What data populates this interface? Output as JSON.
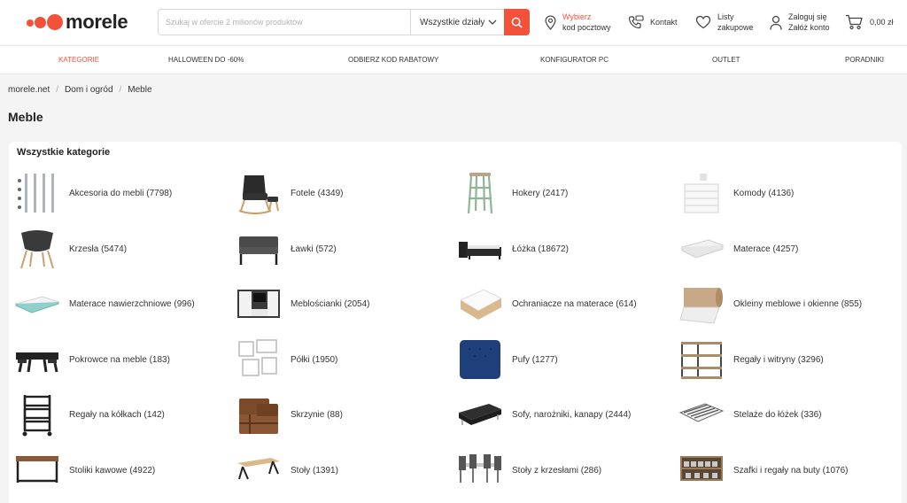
{
  "brand": {
    "name": "morele",
    "color": "#f4513a"
  },
  "search": {
    "placeholder": "Szukaj w ofercie 2 milionów produktów",
    "category": "Wszystkie działy"
  },
  "header": {
    "postcode_title": "Wybierz",
    "postcode_sub": "kod pocztowy",
    "contact": "Kontakt",
    "lists_line1": "Listy",
    "lists_line2": "zakupowe",
    "login_line1": "Zaloguj się",
    "login_line2": "Załóż konto",
    "cart_total": "0,00 zł"
  },
  "nav": [
    "KATEGORIE",
    "HALLOWEEN DO -60%",
    "ODBIERZ KOD RABATOWY",
    "KONFIGURATOR PC",
    "OUTLET",
    "PORADNIKI"
  ],
  "breadcrumb": [
    "morele.net",
    "Dom i ogród",
    "Meble"
  ],
  "page_title": "Meble",
  "section_title": "Wszystkie kategorie",
  "categories": [
    {
      "label": "Akcesoria do mebli (7798)",
      "icon": "furniture-legs-icon"
    },
    {
      "label": "Fotele (4349)",
      "icon": "armchair-icon"
    },
    {
      "label": "Hokery (2417)",
      "icon": "bar-stool-icon"
    },
    {
      "label": "Komody (4136)",
      "icon": "dresser-icon"
    },
    {
      "label": "Krzesła (5474)",
      "icon": "chair-icon"
    },
    {
      "label": "Ławki (572)",
      "icon": "bench-icon"
    },
    {
      "label": "Łóżka (18672)",
      "icon": "bed-icon"
    },
    {
      "label": "Materace (4257)",
      "icon": "mattress-icon"
    },
    {
      "label": "Materace nawierzchniowe (996)",
      "icon": "mattress-topper-icon"
    },
    {
      "label": "Meblościanki (2054)",
      "icon": "wall-unit-icon"
    },
    {
      "label": "Ochraniacze na materace (614)",
      "icon": "mattress-protector-icon"
    },
    {
      "label": "Okleiny meblowe i okienne (855)",
      "icon": "veneer-roll-icon"
    },
    {
      "label": "Pokrowce na meble (183)",
      "icon": "furniture-cover-icon"
    },
    {
      "label": "Półki (1950)",
      "icon": "shelves-icon"
    },
    {
      "label": "Pufy (1277)",
      "icon": "pouffe-icon"
    },
    {
      "label": "Regały i witryny (3296)",
      "icon": "shelving-unit-icon"
    },
    {
      "label": "Regały na kółkach (142)",
      "icon": "rolling-cart-icon"
    },
    {
      "label": "Skrzynie (88)",
      "icon": "chest-icon"
    },
    {
      "label": "Sofy, narożniki, kanapy (2444)",
      "icon": "sofa-icon"
    },
    {
      "label": "Stelaże do łóżek (336)",
      "icon": "slatted-frame-icon"
    },
    {
      "label": "Stoliki kawowe (4922)",
      "icon": "coffee-table-icon"
    },
    {
      "label": "Stoły (1391)",
      "icon": "table-icon"
    },
    {
      "label": "Stoły z krzesłami (286)",
      "icon": "dining-set-icon"
    },
    {
      "label": "Szafki i regały na buty (1076)",
      "icon": "shoe-rack-icon"
    }
  ]
}
